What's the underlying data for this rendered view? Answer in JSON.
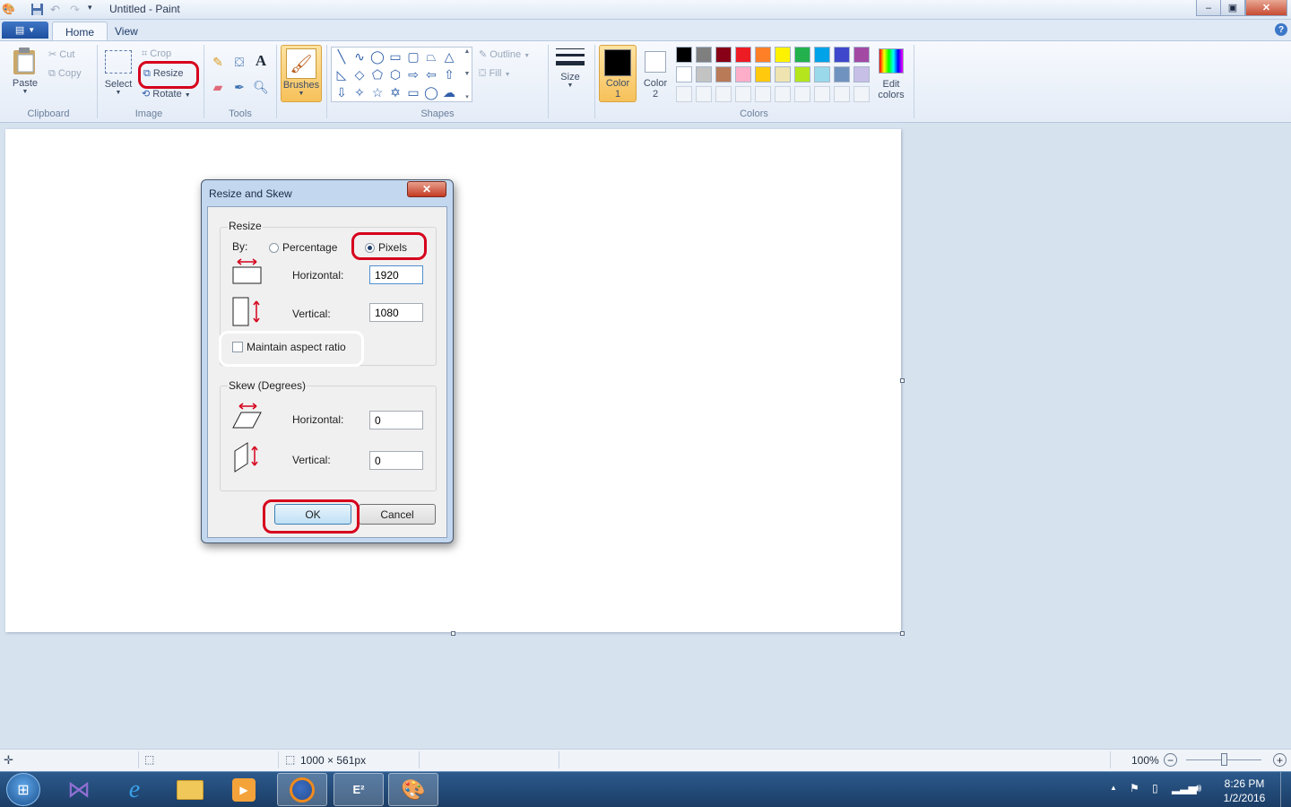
{
  "window": {
    "title": "Untitled - Paint",
    "controls": {
      "minimize": "–",
      "maximize": "▣",
      "close": "✕"
    }
  },
  "tabs": [
    {
      "label": "Home",
      "active": true
    },
    {
      "label": "View",
      "active": false
    }
  ],
  "help_icon": "?",
  "ribbon": {
    "clipboard": {
      "paste": "Paste",
      "cut": "Cut",
      "copy": "Copy",
      "group": "Clipboard"
    },
    "image": {
      "select": "Select",
      "crop": "Crop",
      "resize": "Resize",
      "rotate": "Rotate",
      "group": "Image"
    },
    "tools": {
      "group": "Tools",
      "text_tool": "A"
    },
    "brushes": {
      "label": "Brushes"
    },
    "shapes": {
      "outline": "Outline",
      "fill": "Fill",
      "group": "Shapes"
    },
    "size": {
      "label": "Size"
    },
    "colors": {
      "color1": "Color\n1",
      "color2": "Color\n2",
      "edit": "Edit\ncolors",
      "group": "Colors",
      "color1_value": "#000000",
      "color2_value": "#ffffff",
      "palette_row1": [
        "#000000",
        "#7f7f7f",
        "#880015",
        "#ed1c24",
        "#ff7f27",
        "#fff200",
        "#22b14c",
        "#00a2e8",
        "#3f48cc",
        "#a349a4"
      ],
      "palette_row2": [
        "#ffffff",
        "#c3c3c3",
        "#b97a57",
        "#ffaec9",
        "#ffc90e",
        "#efe4b0",
        "#b5e61d",
        "#99d9ea",
        "#7092be",
        "#c8bfe7"
      ]
    }
  },
  "dialog": {
    "title": "Resize and Skew",
    "close": "✕",
    "resize": {
      "legend": "Resize",
      "by": "By:",
      "percentage": "Percentage",
      "pixels": "Pixels",
      "selected": "pixels",
      "horizontal_label": "Horizontal:",
      "horizontal_value": "1920",
      "vertical_label": "Vertical:",
      "vertical_value": "1080",
      "maintain": "Maintain aspect ratio",
      "maintain_checked": false
    },
    "skew": {
      "legend": "Skew (Degrees)",
      "horizontal_label": "Horizontal:",
      "horizontal_value": "0",
      "vertical_label": "Vertical:",
      "vertical_value": "0"
    },
    "ok": "OK",
    "cancel": "Cancel"
  },
  "status": {
    "dimensions": "1000 × 561px",
    "zoom": "100%"
  },
  "taskbar": {
    "time": "8:26 PM",
    "date": "1/2/2016"
  }
}
